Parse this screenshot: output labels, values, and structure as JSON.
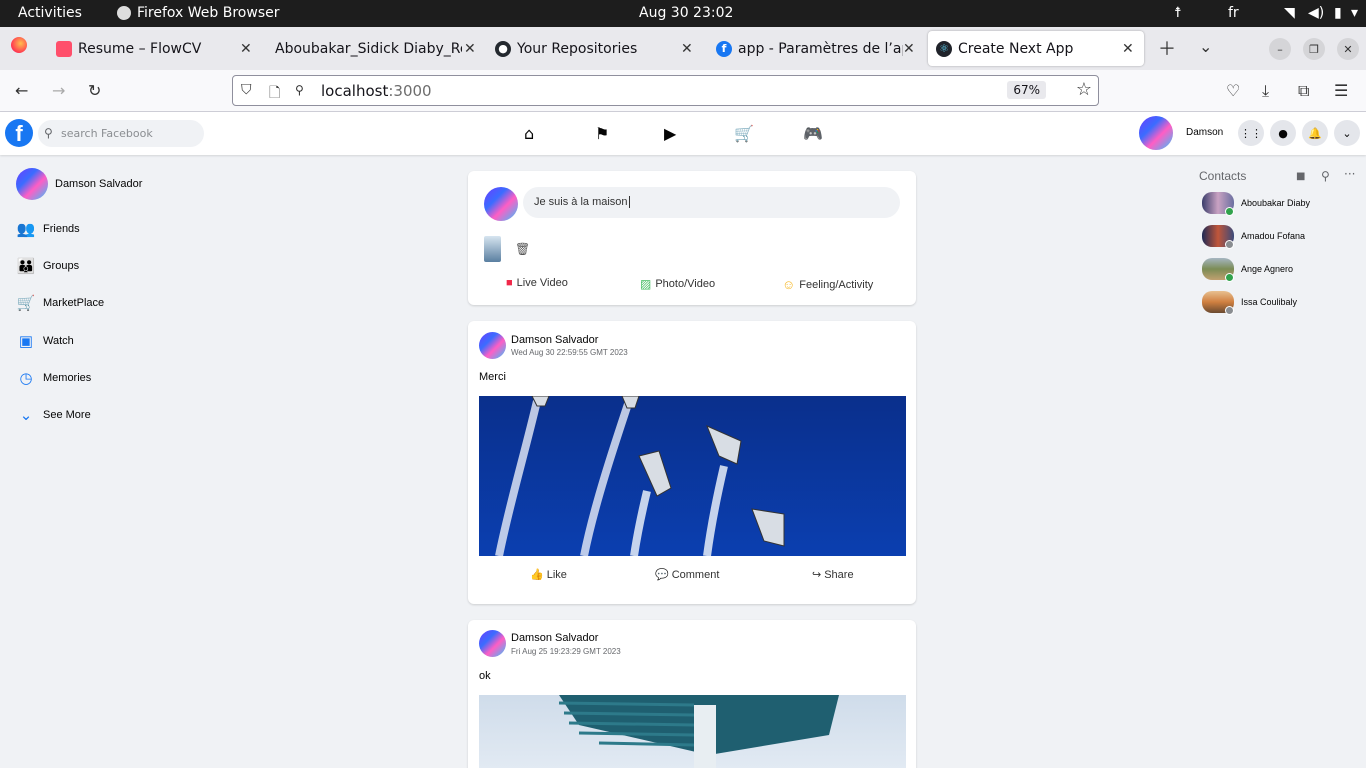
{
  "system": {
    "activities": "Activities",
    "app_name": "Firefox Web Browser",
    "clock": "Aug 30  23:02",
    "lang": "fr"
  },
  "tabs": [
    {
      "title": "Resume – FlowCV",
      "icon": "flowcv-icon"
    },
    {
      "title": "Aboubakar_Sidick Diaby_Re",
      "icon": "none"
    },
    {
      "title": "Your Repositories",
      "icon": "github-icon"
    },
    {
      "title": "app - Paramètres de l’app",
      "icon": "facebook-icon"
    },
    {
      "title": "Create Next App",
      "icon": "react-icon",
      "active": true
    }
  ],
  "navbar": {
    "url_host": "localhost",
    "url_port": ":3000",
    "zoom": "67%"
  },
  "fb": {
    "search_placeholder": "search Facebook",
    "user_short": "Damson",
    "brand_color": "#1877f2"
  },
  "sidebar": {
    "user": "Damson Salvador",
    "items": [
      {
        "label": "Friends",
        "icon": "friends-icon"
      },
      {
        "label": "Groups",
        "icon": "groups-icon"
      },
      {
        "label": "MarketPlace",
        "icon": "cart-icon"
      },
      {
        "label": "Watch",
        "icon": "watch-icon"
      },
      {
        "label": "Memories",
        "icon": "memories-icon"
      },
      {
        "label": "See More",
        "icon": "chevron-down-icon"
      }
    ]
  },
  "composer": {
    "value": "Je suis à la maison",
    "actions": {
      "live": "Live Video",
      "photo": "Photo/Video",
      "feeling": "Feeling/Activity"
    }
  },
  "posts": [
    {
      "author": "Damson Salvador",
      "date": "Wed Aug 30 22:59:55 GMT 2023",
      "text": "Merci"
    },
    {
      "author": "Damson Salvador",
      "date": "Fri Aug 25 19:23:29 GMT 2023",
      "text": "ok"
    }
  ],
  "post_actions": {
    "like": "Like",
    "comment": "Comment",
    "share": "Share"
  },
  "contacts": {
    "title": "Contacts",
    "list": [
      {
        "name": "Aboubakar Diaby",
        "online": true
      },
      {
        "name": "Amadou Fofana",
        "online": false
      },
      {
        "name": "Ange Agnero",
        "online": true
      },
      {
        "name": "Issa Coulibaly",
        "online": false
      }
    ]
  }
}
